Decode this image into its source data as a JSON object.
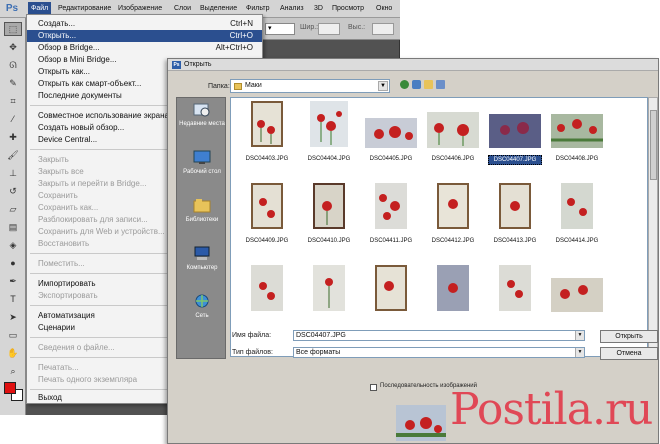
{
  "app": {
    "logo": "Ps",
    "menubar": [
      {
        "label": "Файл",
        "active": true
      },
      {
        "label": "Редактирование"
      },
      {
        "label": "Изображение"
      },
      {
        "label": "Слои"
      },
      {
        "label": "Выделение"
      },
      {
        "label": "Фильтр"
      },
      {
        "label": "Анализ"
      },
      {
        "label": "3D"
      },
      {
        "label": "Просмотр"
      },
      {
        "label": "Окно"
      }
    ],
    "options_bar": {
      "shape_label": "Шир.:",
      "height_label": "Выс.:"
    }
  },
  "file_menu": {
    "items": [
      {
        "label": "Создать...",
        "shortcut": "Ctrl+N",
        "state": "enabled"
      },
      {
        "label": "Открыть...",
        "shortcut": "Ctrl+O",
        "state": "highlighted"
      },
      {
        "label": "Обзор в Bridge...",
        "shortcut": "Alt+Ctrl+O",
        "state": "enabled"
      },
      {
        "label": "Обзор в Mini Bridge...",
        "shortcut": "",
        "state": "enabled"
      },
      {
        "label": "Открыть как...",
        "shortcut": "",
        "state": "enabled"
      },
      {
        "label": "Открыть как смарт-объект...",
        "shortcut": "",
        "state": "enabled"
      },
      {
        "label": "Последние документы",
        "shortcut": "",
        "state": "enabled"
      },
      {
        "label": "Совместное использование экрана",
        "shortcut": "",
        "state": "enabled"
      },
      {
        "label": "Создать новый обзор...",
        "shortcut": "",
        "state": "enabled"
      },
      {
        "label": "Device Central...",
        "shortcut": "",
        "state": "enabled"
      },
      {
        "label": "Закрыть",
        "shortcut": "",
        "state": "disabled"
      },
      {
        "label": "Закрыть все",
        "shortcut": "",
        "state": "disabled"
      },
      {
        "label": "Закрыть и перейти в Bridge...",
        "shortcut": "",
        "state": "disabled"
      },
      {
        "label": "Сохранить",
        "shortcut": "",
        "state": "disabled"
      },
      {
        "label": "Сохранить как...",
        "shortcut": "",
        "state": "disabled"
      },
      {
        "label": "Разблокировать для записи...",
        "shortcut": "",
        "state": "disabled"
      },
      {
        "label": "Сохранить для Web и устройств...",
        "shortcut": "",
        "state": "disabled"
      },
      {
        "label": "Восстановить",
        "shortcut": "",
        "state": "disabled"
      },
      {
        "label": "Поместить...",
        "shortcut": "",
        "state": "disabled"
      },
      {
        "label": "Импортировать",
        "shortcut": "",
        "state": "enabled"
      },
      {
        "label": "Экспортировать",
        "shortcut": "",
        "state": "disabled"
      },
      {
        "label": "Автоматизация",
        "shortcut": "",
        "state": "enabled"
      },
      {
        "label": "Сценарии",
        "shortcut": "",
        "state": "enabled"
      },
      {
        "label": "Сведения о файле...",
        "shortcut": "",
        "state": "disabled"
      },
      {
        "label": "Печатать...",
        "shortcut": "",
        "state": "disabled"
      },
      {
        "label": "Печать одного экземпляра",
        "shortcut": "",
        "state": "disabled"
      },
      {
        "label": "Выход",
        "shortcut": "",
        "state": "enabled"
      }
    ]
  },
  "dialog": {
    "title": "Открыть",
    "folder_label": "Папка:",
    "folder_value": "Маки",
    "places": [
      {
        "label": "Недавние места",
        "icon": "recent-places-icon"
      },
      {
        "label": "Рабочий стол",
        "icon": "desktop-icon"
      },
      {
        "label": "Библиотеки",
        "icon": "libraries-icon"
      },
      {
        "label": "Компьютер",
        "icon": "computer-icon"
      },
      {
        "label": "Сеть",
        "icon": "network-icon"
      }
    ],
    "files": [
      {
        "name": "DSC04403.JPG",
        "selected": false
      },
      {
        "name": "DSC04404.JPG",
        "selected": false
      },
      {
        "name": "DSC04405.JPG",
        "selected": false
      },
      {
        "name": "DSC04406.JPG",
        "selected": false
      },
      {
        "name": "DSC04407.JPG",
        "selected": true
      },
      {
        "name": "DSC04408.JPG",
        "selected": false
      },
      {
        "name": "DSC04409.JPG",
        "selected": false
      },
      {
        "name": "DSC04410.JPG",
        "selected": false
      },
      {
        "name": "DSC04411.JPG",
        "selected": false
      },
      {
        "name": "DSC04412.JPG",
        "selected": false
      },
      {
        "name": "DSC04413.JPG",
        "selected": false
      },
      {
        "name": "DSC04414.JPG",
        "selected": false
      },
      {
        "name": "",
        "selected": false
      },
      {
        "name": "",
        "selected": false
      },
      {
        "name": "",
        "selected": false
      },
      {
        "name": "",
        "selected": false
      },
      {
        "name": "",
        "selected": false
      },
      {
        "name": "",
        "selected": false
      }
    ],
    "filename_label": "Имя файла:",
    "filename_value": "DSC04407.JPG",
    "filetype_label": "Тип файлов:",
    "filetype_value": "Все форматы",
    "open_button": "Открыть",
    "cancel_button": "Отмена",
    "sequence_label": "Последовательность изображений"
  },
  "watermark": "Postila.ru",
  "colors": {
    "accent": "#2b4f8f",
    "foreground_swatch": "#e01010"
  }
}
